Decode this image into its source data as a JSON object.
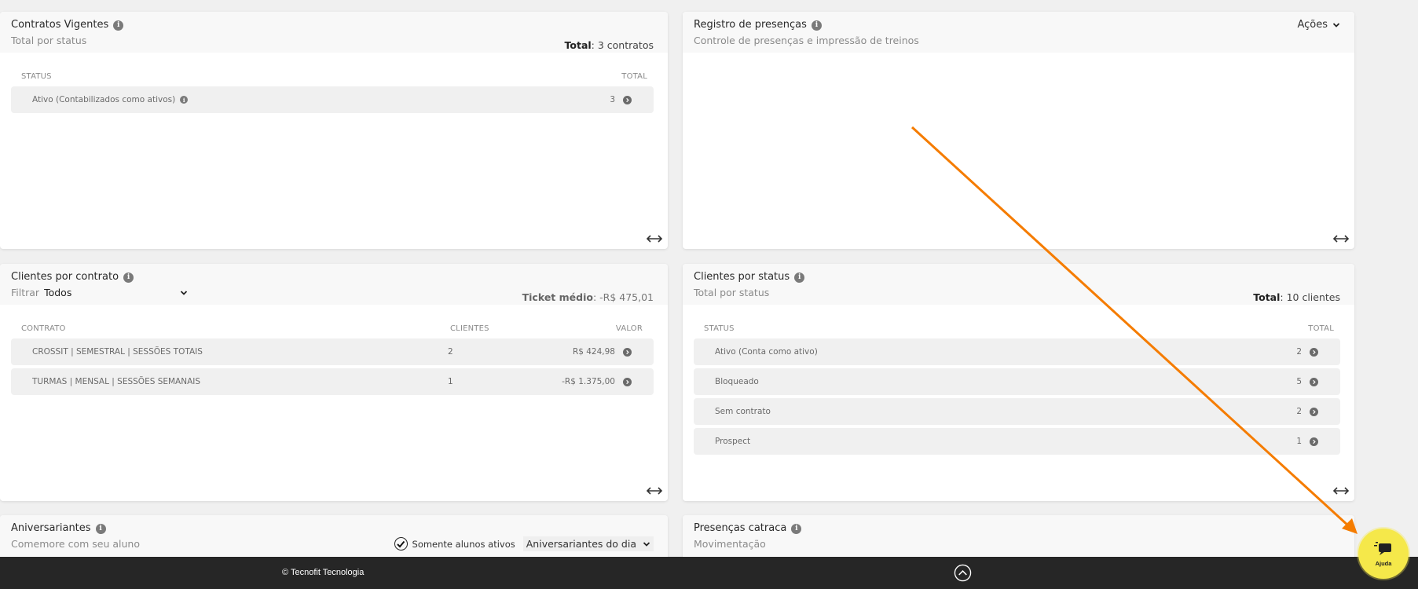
{
  "contratos": {
    "title": "Contratos Vigentes",
    "subtitle": "Total por status",
    "total_label": "Total",
    "total_value": ": 3 contratos",
    "col_status": "STATUS",
    "col_total": "TOTAL",
    "rows": [
      {
        "label": "Ativo (Contabilizados como ativos)",
        "total": "3"
      }
    ]
  },
  "presencas": {
    "title": "Registro de presenças",
    "subtitle": "Controle de presenças e impressão de treinos",
    "actions_label": "Ações"
  },
  "clientes_contrato": {
    "title": "Clientes por contrato",
    "filter_label": "Filtrar",
    "filter_value": "Todos",
    "ticket_label": "Ticket médio",
    "ticket_value": ": -R$ 475,01",
    "col_contrato": "CONTRATO",
    "col_clientes": "CLIENTES",
    "col_valor": "VALOR",
    "rows": [
      {
        "contrato": "CROSSIT | SEMESTRAL | SESSÕES TOTAIS",
        "clientes": "2",
        "valor": "R$ 424,98"
      },
      {
        "contrato": "TURMAS | MENSAL | SESSÕES SEMANAIS",
        "clientes": "1",
        "valor": "-R$ 1.375,00"
      }
    ]
  },
  "clientes_status": {
    "title": "Clientes por status",
    "subtitle": "Total por status",
    "total_label": "Total",
    "total_value": ": 10 clientes",
    "col_status": "STATUS",
    "col_total": "TOTAL",
    "rows": [
      {
        "label": "Ativo (Conta como ativo)",
        "total": "2"
      },
      {
        "label": "Bloqueado",
        "total": "5"
      },
      {
        "label": "Sem contrato",
        "total": "2"
      },
      {
        "label": "Prospect",
        "total": "1"
      }
    ]
  },
  "aniversariantes": {
    "title": "Aniversariantes",
    "subtitle": "Comemore com seu aluno",
    "checkbox_label": "Somente alunos ativos",
    "select_value": "Aniversariantes do dia"
  },
  "catraca": {
    "title": "Presenças catraca",
    "subtitle": "Movimentação"
  },
  "footer": {
    "copyright": "© Tecnofit Tecnologia"
  },
  "help": {
    "label": "Ajuda"
  },
  "colors": {
    "arrow": "#f57c00",
    "help_bg": "#f5e84a",
    "footer_bg": "#262626"
  }
}
